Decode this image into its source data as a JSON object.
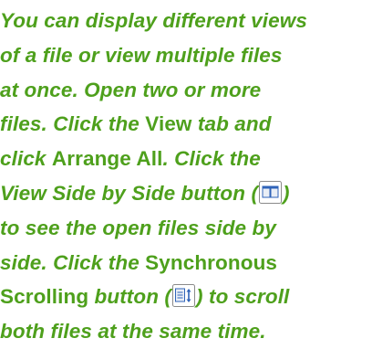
{
  "tip": {
    "line1": "You can display different views",
    "line2": "of a file or view multiple files",
    "line3": "at once. Open two or more",
    "line4a": "files. Click the ",
    "line4b": "View",
    "line4c": " tab and",
    "line5a": "click ",
    "line5b": "Arrange All",
    "line5c": ". Click the",
    "line6a": "View Side by Side button (",
    "line6b": ")",
    "line7": "to see the open files side by",
    "line8a": "side. Click the ",
    "line8b": "Synchronous",
    "line9a": "Scrolling",
    "line9b": " button (",
    "line9c": ") to scroll",
    "line10": "both files at the same time."
  },
  "icons": {
    "side_by_side": "view-side-by-side-icon",
    "sync_scroll": "synchronous-scrolling-icon"
  },
  "colors": {
    "text": "#4ea01c",
    "icon_border": "#8a8a8a",
    "icon_fill": "#e9eef6",
    "icon_accent": "#2f63b8"
  }
}
